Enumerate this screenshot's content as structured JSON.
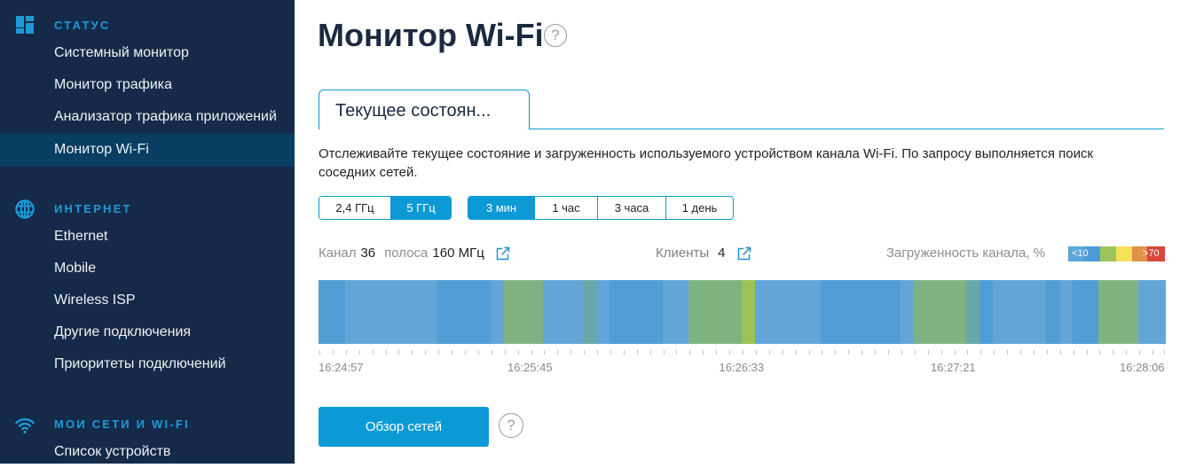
{
  "sidebar": {
    "sections": [
      {
        "title": "СТАТУС",
        "icon": "dashboard-icon",
        "items": [
          {
            "label": "Системный монитор",
            "active": false
          },
          {
            "label": "Монитор трафика",
            "active": false
          },
          {
            "label": "Анализатор трафика приложений",
            "active": false
          },
          {
            "label": "Монитор Wi-Fi",
            "active": true
          }
        ]
      },
      {
        "title": "ИНТЕРНЕТ",
        "icon": "globe-icon",
        "items": [
          {
            "label": "Ethernet"
          },
          {
            "label": "Mobile"
          },
          {
            "label": "Wireless ISP"
          },
          {
            "label": "Другие подключения"
          },
          {
            "label": "Приоритеты подключений"
          }
        ]
      },
      {
        "title": "МОИ СЕТИ И WI-FI",
        "icon": "wifi-icon",
        "items": [
          {
            "label": "Список устройств"
          }
        ]
      }
    ]
  },
  "page": {
    "title": "Монитор Wi-Fi",
    "help_glyph": "?"
  },
  "tabs": [
    {
      "label": "Текущее состоян...",
      "active": true
    }
  ],
  "description": {
    "line1": "Отслеживайте текущее состояние и загруженность используемого устройством канала Wi-Fi. По запросу выполняется поиск",
    "line2": "соседних сетей."
  },
  "band_selector": {
    "options": [
      {
        "label": "2,4 ГГц",
        "selected": false
      },
      {
        "label": "5 ГГц",
        "selected": true
      }
    ]
  },
  "period_selector": {
    "options": [
      {
        "label": "3 мин",
        "selected": true
      },
      {
        "label": "1 час",
        "selected": false
      },
      {
        "label": "3 часа",
        "selected": false
      },
      {
        "label": "1 день",
        "selected": false
      }
    ]
  },
  "info": {
    "channel_label": "Канал",
    "channel": "36",
    "band_label": "полоса",
    "bandwidth": "160 МГц",
    "clients_label": "Клиенты",
    "clients": "4",
    "load_label": "Загруженность канала, %"
  },
  "legend": {
    "min_label": "<10",
    "max_label": ">70",
    "colors": [
      "#5ba6dc",
      "#4e9bd7",
      "#9cc45a",
      "#f8e15a",
      "#e0914a",
      "#d9473a"
    ]
  },
  "chart_data": {
    "type": "heatmap",
    "title": "",
    "xlabel": "",
    "ylabel": "",
    "start_time": "16:24:57",
    "end_time": "16:28:06",
    "sample_interval_seconds": 3,
    "palette": {
      "lt": "#63a5d7",
      "bl": "#519dd5",
      "gb": "#80b382",
      "tl": "#68a8a9",
      "gr": "#9bc256"
    },
    "cells": [
      "bl",
      "bl",
      "lt",
      "lt",
      "lt",
      "lt",
      "lt",
      "lt",
      "lt",
      "bl",
      "bl",
      "bl",
      "bl",
      "lt",
      "gb",
      "gb",
      "gb",
      "lt",
      "lt",
      "lt",
      "tl",
      "lt",
      "bl",
      "bl",
      "bl",
      "bl",
      "lt",
      "lt",
      "gb",
      "gb",
      "gb",
      "gb",
      "gr",
      "lt",
      "lt",
      "lt",
      "lt",
      "lt",
      "bl",
      "bl",
      "bl",
      "bl",
      "bl",
      "bl",
      "lt",
      "gb",
      "gb",
      "gb",
      "gb",
      "tl",
      "bl",
      "lt",
      "lt",
      "lt",
      "lt",
      "bl",
      "lt",
      "bl",
      "bl",
      "gb",
      "gb",
      "gb",
      "lt",
      "lt"
    ],
    "tick_labels": [
      {
        "label": "16:24:57",
        "sample_index": 0
      },
      {
        "label": "16:25:45",
        "sample_index": 16
      },
      {
        "label": "16:26:33",
        "sample_index": 32
      },
      {
        "label": "16:27:21",
        "sample_index": 48
      },
      {
        "label": "16:28:06",
        "sample_index": 63
      }
    ]
  },
  "actions": {
    "scan_button": "Обзор сетей",
    "help_glyph": "?"
  },
  "colors": {
    "accent": "#0b9ad5",
    "sidebar_bg": "#142a48",
    "sidebar_active_bg": "#073e62",
    "section_title": "#1e9ad6",
    "link_icon": "#1a8fcf"
  }
}
